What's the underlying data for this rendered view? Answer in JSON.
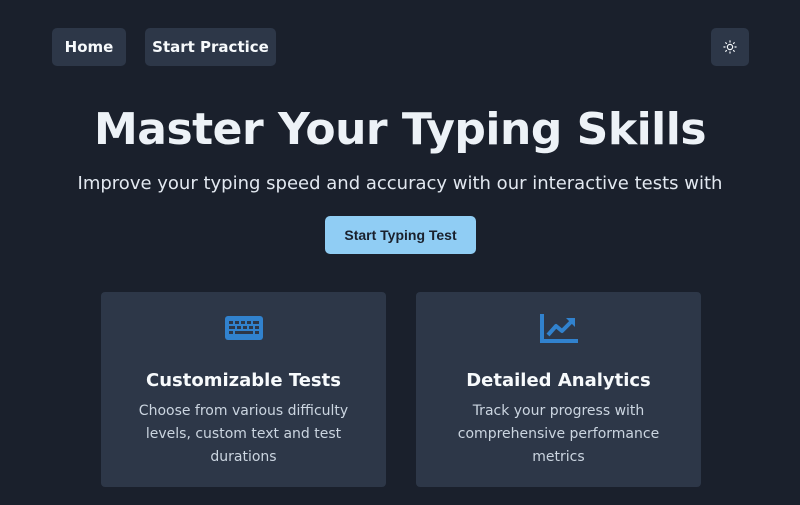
{
  "nav": {
    "home_label": "Home",
    "practice_label": "Start Practice",
    "theme_icon": "sun-icon"
  },
  "hero": {
    "title": "Master Your Typing Skills",
    "subtitle": "Improve your typing speed and accuracy with our interactive tests with",
    "cta_label": "Start Typing Test"
  },
  "features": [
    {
      "icon": "keyboard-icon",
      "title": "Customizable Tests",
      "description": "Choose from various difficulty levels, custom text and test durations"
    },
    {
      "icon": "chart-line-icon",
      "title": "Detailed Analytics",
      "description": "Track your progress with comprehensive performance metrics"
    }
  ],
  "colors": {
    "background": "#1a202c",
    "surface": "#2d3748",
    "accent": "#90cdf4",
    "icon": "#3182ce"
  }
}
